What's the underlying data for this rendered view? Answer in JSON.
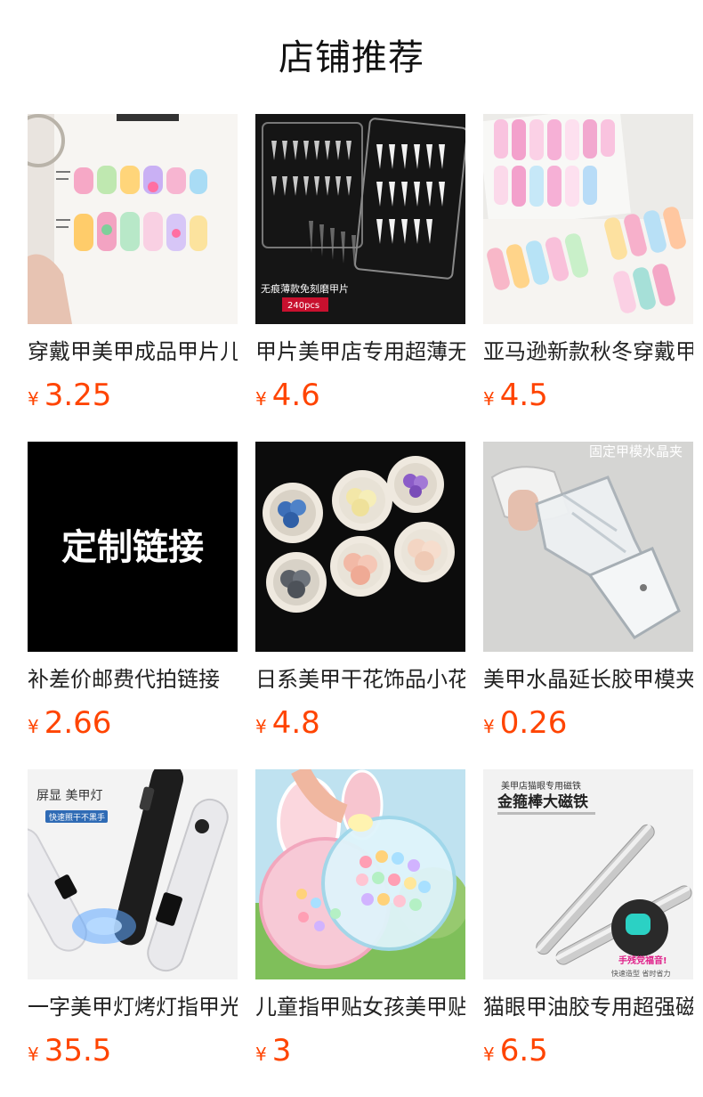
{
  "header": {
    "title": "店铺推荐"
  },
  "currency_symbol": "¥",
  "products": [
    {
      "name": "穿戴甲美甲成品甲片儿童可爱",
      "price": "3.25",
      "image": "kids-press-on-nails-card"
    },
    {
      "name": "甲片美甲店专用超薄无痕免刻磨",
      "price": "4.6",
      "image": "clear-nail-tips-box",
      "overlay_text": [
        "无痕薄款免刻磨甲片",
        "240pcs"
      ]
    },
    {
      "name": "亚马逊新款秋冬穿戴甲成品",
      "price": "4.5",
      "image": "colorful-press-on-nails"
    },
    {
      "name": "补差价邮费代拍链接",
      "price": "2.66",
      "image": "custom-link-banner",
      "overlay_text": [
        "定制链接"
      ]
    },
    {
      "name": "日系美甲干花饰品小花朵",
      "price": "4.8",
      "image": "dried-flower-jars"
    },
    {
      "name": "美甲水晶延长胶甲模夹子",
      "price": "0.26",
      "image": "crystal-nail-clip",
      "overlay_text": [
        "固定甲模水晶夹"
      ]
    },
    {
      "name": "一字美甲灯烤灯指甲光疗灯",
      "price": "35.5",
      "image": "uv-nail-lamp-pen",
      "overlay_text": [
        "屏显 美甲灯",
        "快速照干不黑手"
      ]
    },
    {
      "name": "儿童指甲贴女孩美甲贴纸",
      "price": "3",
      "image": "kids-nail-sticker-case"
    },
    {
      "name": "猫眼甲油胶专用超强磁铁",
      "price": "6.5",
      "image": "cat-eye-magnet-stick",
      "overlay_text": [
        "美甲店猫眼专用磁铁",
        "金箍棒大磁铁",
        "手残党福音!",
        "快速造型 省时省力"
      ]
    }
  ]
}
